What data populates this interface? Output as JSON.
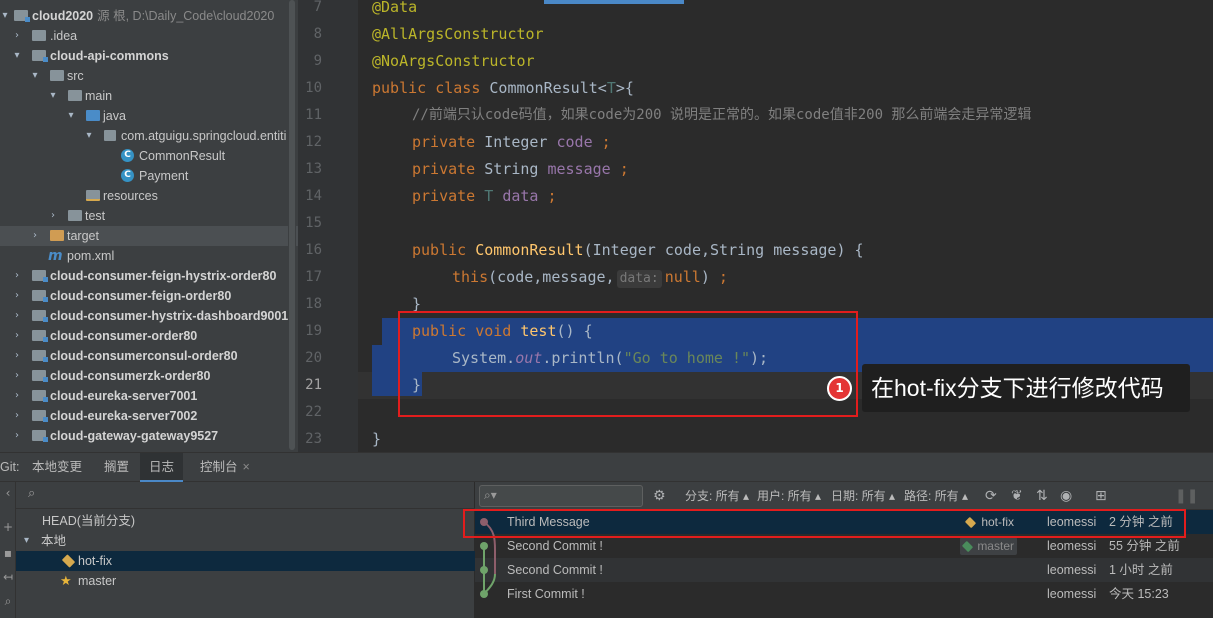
{
  "project_tree": {
    "root": {
      "name": "cloud2020",
      "meta": "源 根, D:\\Daily_Code\\cloud2020"
    },
    "items": [
      {
        "label": ".idea"
      },
      {
        "label": "cloud-api-commons"
      },
      {
        "label": "src"
      },
      {
        "label": "main"
      },
      {
        "label": "java"
      },
      {
        "label": "com.atguigu.springcloud.entiti"
      },
      {
        "label": "CommonResult"
      },
      {
        "label": "Payment"
      },
      {
        "label": "resources"
      },
      {
        "label": "test"
      },
      {
        "label": "target"
      },
      {
        "label": "pom.xml"
      },
      {
        "label": "cloud-consumer-feign-hystrix-order80"
      },
      {
        "label": "cloud-consumer-feign-order80"
      },
      {
        "label": "cloud-consumer-hystrix-dashboard9001"
      },
      {
        "label": "cloud-consumer-order80"
      },
      {
        "label": "cloud-consumerconsul-order80"
      },
      {
        "label": "cloud-consumerzk-order80"
      },
      {
        "label": "cloud-eureka-server7001"
      },
      {
        "label": "cloud-eureka-server7002"
      },
      {
        "label": "cloud-gateway-gateway9527"
      }
    ]
  },
  "editor": {
    "line_numbers": [
      "7",
      "8",
      "9",
      "10",
      "11",
      "12",
      "13",
      "14",
      "15",
      "16",
      "17",
      "18",
      "19",
      "20",
      "21",
      "22",
      "23"
    ],
    "code": {
      "l7": "@Data",
      "l8": "@AllArgsConstructor",
      "l9": "@NoArgsConstructor",
      "l10_kw": "public class ",
      "l10_name": "CommonResult<",
      "l10_t": "T",
      "l10_end": ">{",
      "l11": "//前端只认code码值，如果code为200 说明是正常的。如果code值非200 那么前端会走异常逻辑",
      "l12_kw": "private ",
      "l12_type": "Integer ",
      "l12_field": "code ",
      "l12_end": ";",
      "l13_kw": "private ",
      "l13_type": "String ",
      "l13_field": "message ",
      "l13_end": ";",
      "l14_kw": "private ",
      "l14_type": "T ",
      "l14_field": "data ",
      "l14_end": ";",
      "l16_kw": "public ",
      "l16_fn": "CommonResult",
      "l16_params": "(Integer code,String message) {",
      "l17_kw": "this",
      "l17_args": "(code,message,",
      "l17_hint": "data:",
      "l17_null": "null",
      "l17_end": ") ",
      "l17_semi": ";",
      "l18": "}",
      "l19_kw": "public void ",
      "l19_fn": "test",
      "l19_end": "() {",
      "l20_a": "System.",
      "l20_out": "out",
      "l20_b": ".println(",
      "l20_str": "\"Go to home !\"",
      "l20_c": ");",
      "l21": "}",
      "l23": "}"
    }
  },
  "annotation": {
    "badge": "1",
    "text": "在hot-fix分支下进行修改代码"
  },
  "bottom_tabs": {
    "prefix": "Git:",
    "tabs": [
      "本地变更",
      "搁置",
      "日志",
      "控制台"
    ],
    "close": "×"
  },
  "branches": {
    "head": "HEAD(当前分支)",
    "local": "本地",
    "items": [
      "hot-fix",
      "master"
    ]
  },
  "log": {
    "filters": [
      "分支: 所有",
      "用户: 所有",
      "日期: 所有",
      "路径: 所有"
    ],
    "commits": [
      {
        "message": "Third Message",
        "refs": "hot-fix",
        "author": "leomessi",
        "date": "2 分钟 之前"
      },
      {
        "message": "Second Commit !",
        "refs": "master",
        "author": "leomessi",
        "date": "55 分钟 之前"
      },
      {
        "message": "Second Commit !",
        "refs": "",
        "author": "leomessi",
        "date": "1 小时 之前"
      },
      {
        "message": "First Commit !",
        "refs": "",
        "author": "leomessi",
        "date": "今天 15:23"
      }
    ]
  },
  "colors": {
    "selection": "#214283",
    "annotation_red": "#e21d1d",
    "accent": "#4a88c7"
  }
}
